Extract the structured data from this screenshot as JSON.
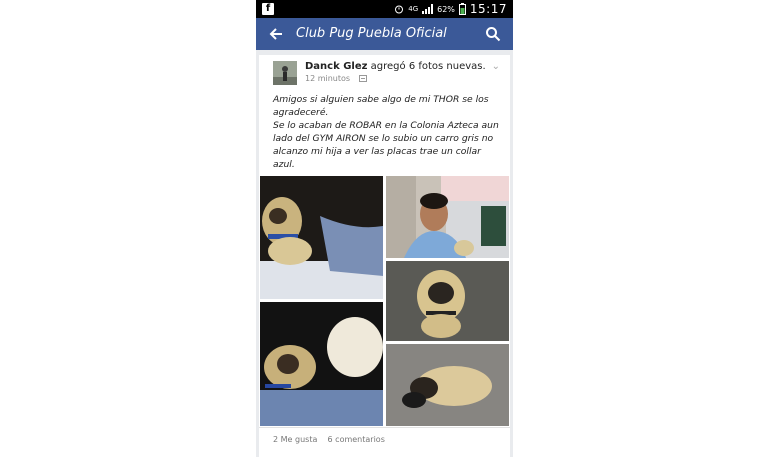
{
  "status_bar": {
    "network": "4G",
    "battery": "62%",
    "time": "15:17"
  },
  "app_bar": {
    "title": "Club Pug Puebla Oficial"
  },
  "post": {
    "author": "Danck Glez",
    "action": "agregó 6 fotos nuevas.",
    "time": "12 minutos",
    "text_line1": "Amigos si alguien sabe algo de mi THOR se los agradeceré.",
    "text_line2": "Se lo acaban de ROBAR en la Colonia Azteca aun lado del GYM AIRON se lo subio un carro gris no alcanzo mi hija a ver las placas trae un collar azul.",
    "likes": "2 Me gusta",
    "comments": "6 comentarios"
  },
  "icons": {
    "facebook": "facebook-icon",
    "back": "back-arrow-icon",
    "search": "search-icon",
    "privacy": "privacy-icon",
    "chevron": "chevron-down-icon"
  },
  "colors": {
    "brand": "#3b5998",
    "statusbar": "#000000"
  }
}
